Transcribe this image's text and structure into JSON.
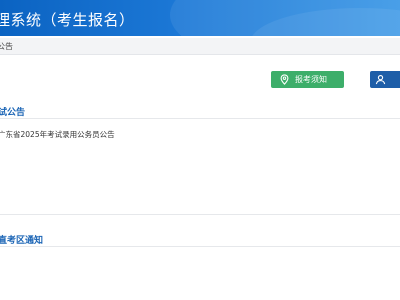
{
  "header": {
    "title": "理系统（考生报名）"
  },
  "breadcrumb": {
    "text": "公告"
  },
  "buttons": {
    "exam_notice": "报考须知",
    "secondary": "",
    "colors": {
      "green": "#3dae6a",
      "blue": "#1e5ea8"
    },
    "icons": {
      "exam_notice": "location-pin-icon",
      "secondary": "person-icon"
    }
  },
  "sections": {
    "exam_announcement": {
      "title": "试公告",
      "items": [
        "广东省2025年考试录用公务员公告"
      ]
    },
    "exam_area_notice": {
      "title": "直考区通知"
    }
  },
  "colors": {
    "accent": "#1a64b5",
    "header": "#0b63c2"
  }
}
